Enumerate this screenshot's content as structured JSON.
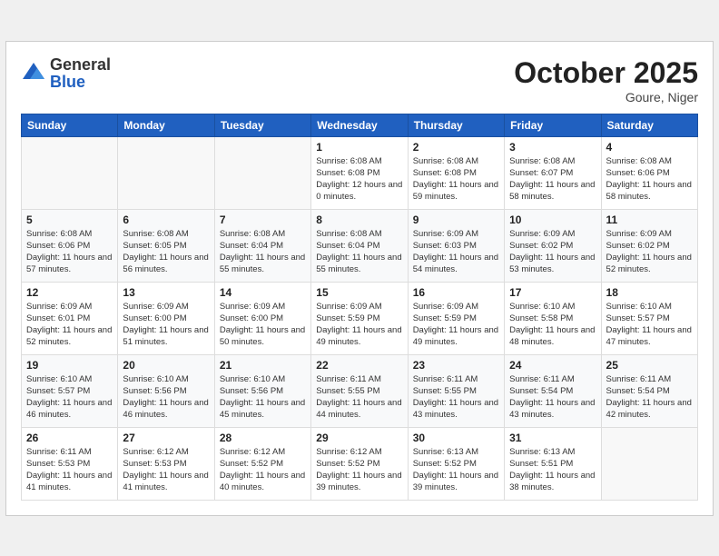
{
  "header": {
    "logo_general": "General",
    "logo_blue": "Blue",
    "month_title": "October 2025",
    "location": "Goure, Niger"
  },
  "days_of_week": [
    "Sunday",
    "Monday",
    "Tuesday",
    "Wednesday",
    "Thursday",
    "Friday",
    "Saturday"
  ],
  "weeks": [
    [
      {
        "day": "",
        "info": ""
      },
      {
        "day": "",
        "info": ""
      },
      {
        "day": "",
        "info": ""
      },
      {
        "day": "1",
        "info": "Sunrise: 6:08 AM\nSunset: 6:08 PM\nDaylight: 12 hours\nand 0 minutes."
      },
      {
        "day": "2",
        "info": "Sunrise: 6:08 AM\nSunset: 6:08 PM\nDaylight: 11 hours\nand 59 minutes."
      },
      {
        "day": "3",
        "info": "Sunrise: 6:08 AM\nSunset: 6:07 PM\nDaylight: 11 hours\nand 58 minutes."
      },
      {
        "day": "4",
        "info": "Sunrise: 6:08 AM\nSunset: 6:06 PM\nDaylight: 11 hours\nand 58 minutes."
      }
    ],
    [
      {
        "day": "5",
        "info": "Sunrise: 6:08 AM\nSunset: 6:06 PM\nDaylight: 11 hours\nand 57 minutes."
      },
      {
        "day": "6",
        "info": "Sunrise: 6:08 AM\nSunset: 6:05 PM\nDaylight: 11 hours\nand 56 minutes."
      },
      {
        "day": "7",
        "info": "Sunrise: 6:08 AM\nSunset: 6:04 PM\nDaylight: 11 hours\nand 55 minutes."
      },
      {
        "day": "8",
        "info": "Sunrise: 6:08 AM\nSunset: 6:04 PM\nDaylight: 11 hours\nand 55 minutes."
      },
      {
        "day": "9",
        "info": "Sunrise: 6:09 AM\nSunset: 6:03 PM\nDaylight: 11 hours\nand 54 minutes."
      },
      {
        "day": "10",
        "info": "Sunrise: 6:09 AM\nSunset: 6:02 PM\nDaylight: 11 hours\nand 53 minutes."
      },
      {
        "day": "11",
        "info": "Sunrise: 6:09 AM\nSunset: 6:02 PM\nDaylight: 11 hours\nand 52 minutes."
      }
    ],
    [
      {
        "day": "12",
        "info": "Sunrise: 6:09 AM\nSunset: 6:01 PM\nDaylight: 11 hours\nand 52 minutes."
      },
      {
        "day": "13",
        "info": "Sunrise: 6:09 AM\nSunset: 6:00 PM\nDaylight: 11 hours\nand 51 minutes."
      },
      {
        "day": "14",
        "info": "Sunrise: 6:09 AM\nSunset: 6:00 PM\nDaylight: 11 hours\nand 50 minutes."
      },
      {
        "day": "15",
        "info": "Sunrise: 6:09 AM\nSunset: 5:59 PM\nDaylight: 11 hours\nand 49 minutes."
      },
      {
        "day": "16",
        "info": "Sunrise: 6:09 AM\nSunset: 5:59 PM\nDaylight: 11 hours\nand 49 minutes."
      },
      {
        "day": "17",
        "info": "Sunrise: 6:10 AM\nSunset: 5:58 PM\nDaylight: 11 hours\nand 48 minutes."
      },
      {
        "day": "18",
        "info": "Sunrise: 6:10 AM\nSunset: 5:57 PM\nDaylight: 11 hours\nand 47 minutes."
      }
    ],
    [
      {
        "day": "19",
        "info": "Sunrise: 6:10 AM\nSunset: 5:57 PM\nDaylight: 11 hours\nand 46 minutes."
      },
      {
        "day": "20",
        "info": "Sunrise: 6:10 AM\nSunset: 5:56 PM\nDaylight: 11 hours\nand 46 minutes."
      },
      {
        "day": "21",
        "info": "Sunrise: 6:10 AM\nSunset: 5:56 PM\nDaylight: 11 hours\nand 45 minutes."
      },
      {
        "day": "22",
        "info": "Sunrise: 6:11 AM\nSunset: 5:55 PM\nDaylight: 11 hours\nand 44 minutes."
      },
      {
        "day": "23",
        "info": "Sunrise: 6:11 AM\nSunset: 5:55 PM\nDaylight: 11 hours\nand 43 minutes."
      },
      {
        "day": "24",
        "info": "Sunrise: 6:11 AM\nSunset: 5:54 PM\nDaylight: 11 hours\nand 43 minutes."
      },
      {
        "day": "25",
        "info": "Sunrise: 6:11 AM\nSunset: 5:54 PM\nDaylight: 11 hours\nand 42 minutes."
      }
    ],
    [
      {
        "day": "26",
        "info": "Sunrise: 6:11 AM\nSunset: 5:53 PM\nDaylight: 11 hours\nand 41 minutes."
      },
      {
        "day": "27",
        "info": "Sunrise: 6:12 AM\nSunset: 5:53 PM\nDaylight: 11 hours\nand 41 minutes."
      },
      {
        "day": "28",
        "info": "Sunrise: 6:12 AM\nSunset: 5:52 PM\nDaylight: 11 hours\nand 40 minutes."
      },
      {
        "day": "29",
        "info": "Sunrise: 6:12 AM\nSunset: 5:52 PM\nDaylight: 11 hours\nand 39 minutes."
      },
      {
        "day": "30",
        "info": "Sunrise: 6:13 AM\nSunset: 5:52 PM\nDaylight: 11 hours\nand 39 minutes."
      },
      {
        "day": "31",
        "info": "Sunrise: 6:13 AM\nSunset: 5:51 PM\nDaylight: 11 hours\nand 38 minutes."
      },
      {
        "day": "",
        "info": ""
      }
    ]
  ]
}
